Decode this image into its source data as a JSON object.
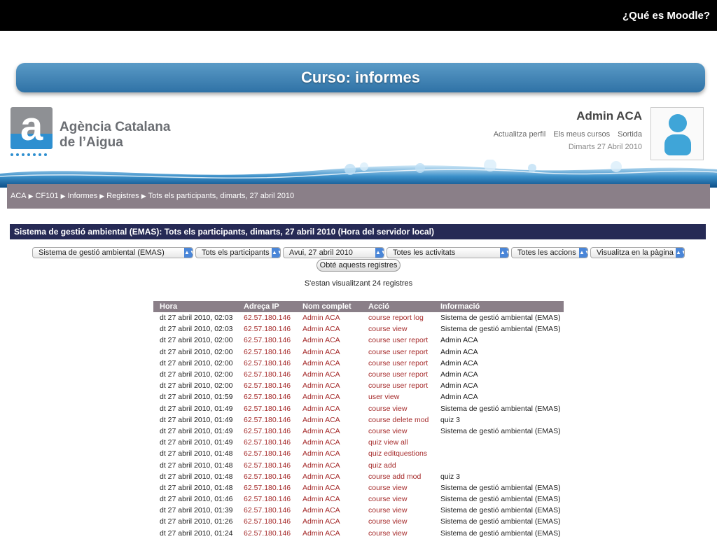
{
  "slide": {
    "header_title": "¿Qué es Moodle?",
    "banner_title": "Curso: informes"
  },
  "site": {
    "org_line1": "Agència Catalana",
    "org_line2": "de l’Aigua",
    "logo_letter": "a",
    "user_name": "Admin ACA",
    "links": [
      "Actualitza perfil",
      "Els meus cursos",
      "Sortida"
    ],
    "date": "Dimarts 27 Abril 2010"
  },
  "breadcrumb": [
    "ACA",
    "CF101",
    "Informes",
    "Registres",
    "Tots els participants, dimarts, 27 abril 2010"
  ],
  "section_title": "Sistema de gestió ambiental (EMAS): Tots els participants, dimarts, 27 abril 2010 (Hora del servidor local)",
  "filters": {
    "course": "Sistema de gestió ambiental (EMAS)",
    "participants": "Tots els participants",
    "day": "Avui, 27 abril 2010",
    "activities": "Totes les activitats",
    "actions": "Totes les accions",
    "display": "Visualitza en la pàgina",
    "submit_label": "Obté aquests registres"
  },
  "count_text": "S'estan visualitzant 24 registres",
  "table": {
    "headers": [
      "Hora",
      "Adreça IP",
      "Nom complet",
      "Acció",
      "Informació"
    ],
    "rows": [
      [
        "dt 27 abril 2010, 02:03",
        "62.57.180.146",
        "Admin ACA",
        "course report log",
        "Sistema de gestió ambiental (EMAS)"
      ],
      [
        "dt 27 abril 2010, 02:03",
        "62.57.180.146",
        "Admin ACA",
        "course view",
        "Sistema de gestió ambiental (EMAS)"
      ],
      [
        "dt 27 abril 2010, 02:00",
        "62.57.180.146",
        "Admin ACA",
        "course user report",
        "Admin ACA"
      ],
      [
        "dt 27 abril 2010, 02:00",
        "62.57.180.146",
        "Admin ACA",
        "course user report",
        "Admin ACA"
      ],
      [
        "dt 27 abril 2010, 02:00",
        "62.57.180.146",
        "Admin ACA",
        "course user report",
        "Admin ACA"
      ],
      [
        "dt 27 abril 2010, 02:00",
        "62.57.180.146",
        "Admin ACA",
        "course user report",
        "Admin ACA"
      ],
      [
        "dt 27 abril 2010, 02:00",
        "62.57.180.146",
        "Admin ACA",
        "course user report",
        "Admin ACA"
      ],
      [
        "dt 27 abril 2010, 01:59",
        "62.57.180.146",
        "Admin ACA",
        "user view",
        "Admin ACA"
      ],
      [
        "dt 27 abril 2010, 01:49",
        "62.57.180.146",
        "Admin ACA",
        "course view",
        "Sistema de gestió ambiental (EMAS)"
      ],
      [
        "dt 27 abril 2010, 01:49",
        "62.57.180.146",
        "Admin ACA",
        "course delete mod",
        "quiz 3"
      ],
      [
        "dt 27 abril 2010, 01:49",
        "62.57.180.146",
        "Admin ACA",
        "course view",
        "Sistema de gestió ambiental (EMAS)"
      ],
      [
        "dt 27 abril 2010, 01:49",
        "62.57.180.146",
        "Admin ACA",
        "quiz view all",
        ""
      ],
      [
        "dt 27 abril 2010, 01:48",
        "62.57.180.146",
        "Admin ACA",
        "quiz editquestions",
        ""
      ],
      [
        "dt 27 abril 2010, 01:48",
        "62.57.180.146",
        "Admin ACA",
        "quiz add",
        ""
      ],
      [
        "dt 27 abril 2010, 01:48",
        "62.57.180.146",
        "Admin ACA",
        "course add mod",
        "quiz 3"
      ],
      [
        "dt 27 abril 2010, 01:48",
        "62.57.180.146",
        "Admin ACA",
        "course view",
        "Sistema de gestió ambiental (EMAS)"
      ],
      [
        "dt 27 abril 2010, 01:46",
        "62.57.180.146",
        "Admin ACA",
        "course view",
        "Sistema de gestió ambiental (EMAS)"
      ],
      [
        "dt 27 abril 2010, 01:39",
        "62.57.180.146",
        "Admin ACA",
        "course view",
        "Sistema de gestió ambiental (EMAS)"
      ],
      [
        "dt 27 abril 2010, 01:26",
        "62.57.180.146",
        "Admin ACA",
        "course view",
        "Sistema de gestió ambiental (EMAS)"
      ],
      [
        "dt 27 abril 2010, 01:24",
        "62.57.180.146",
        "Admin ACA",
        "course view",
        "Sistema de gestió ambiental (EMAS)"
      ]
    ]
  },
  "colors": {
    "banner": "#2f72a6",
    "nav": "#8a7f88",
    "section": "#262a55",
    "link": "#a52a2a"
  }
}
